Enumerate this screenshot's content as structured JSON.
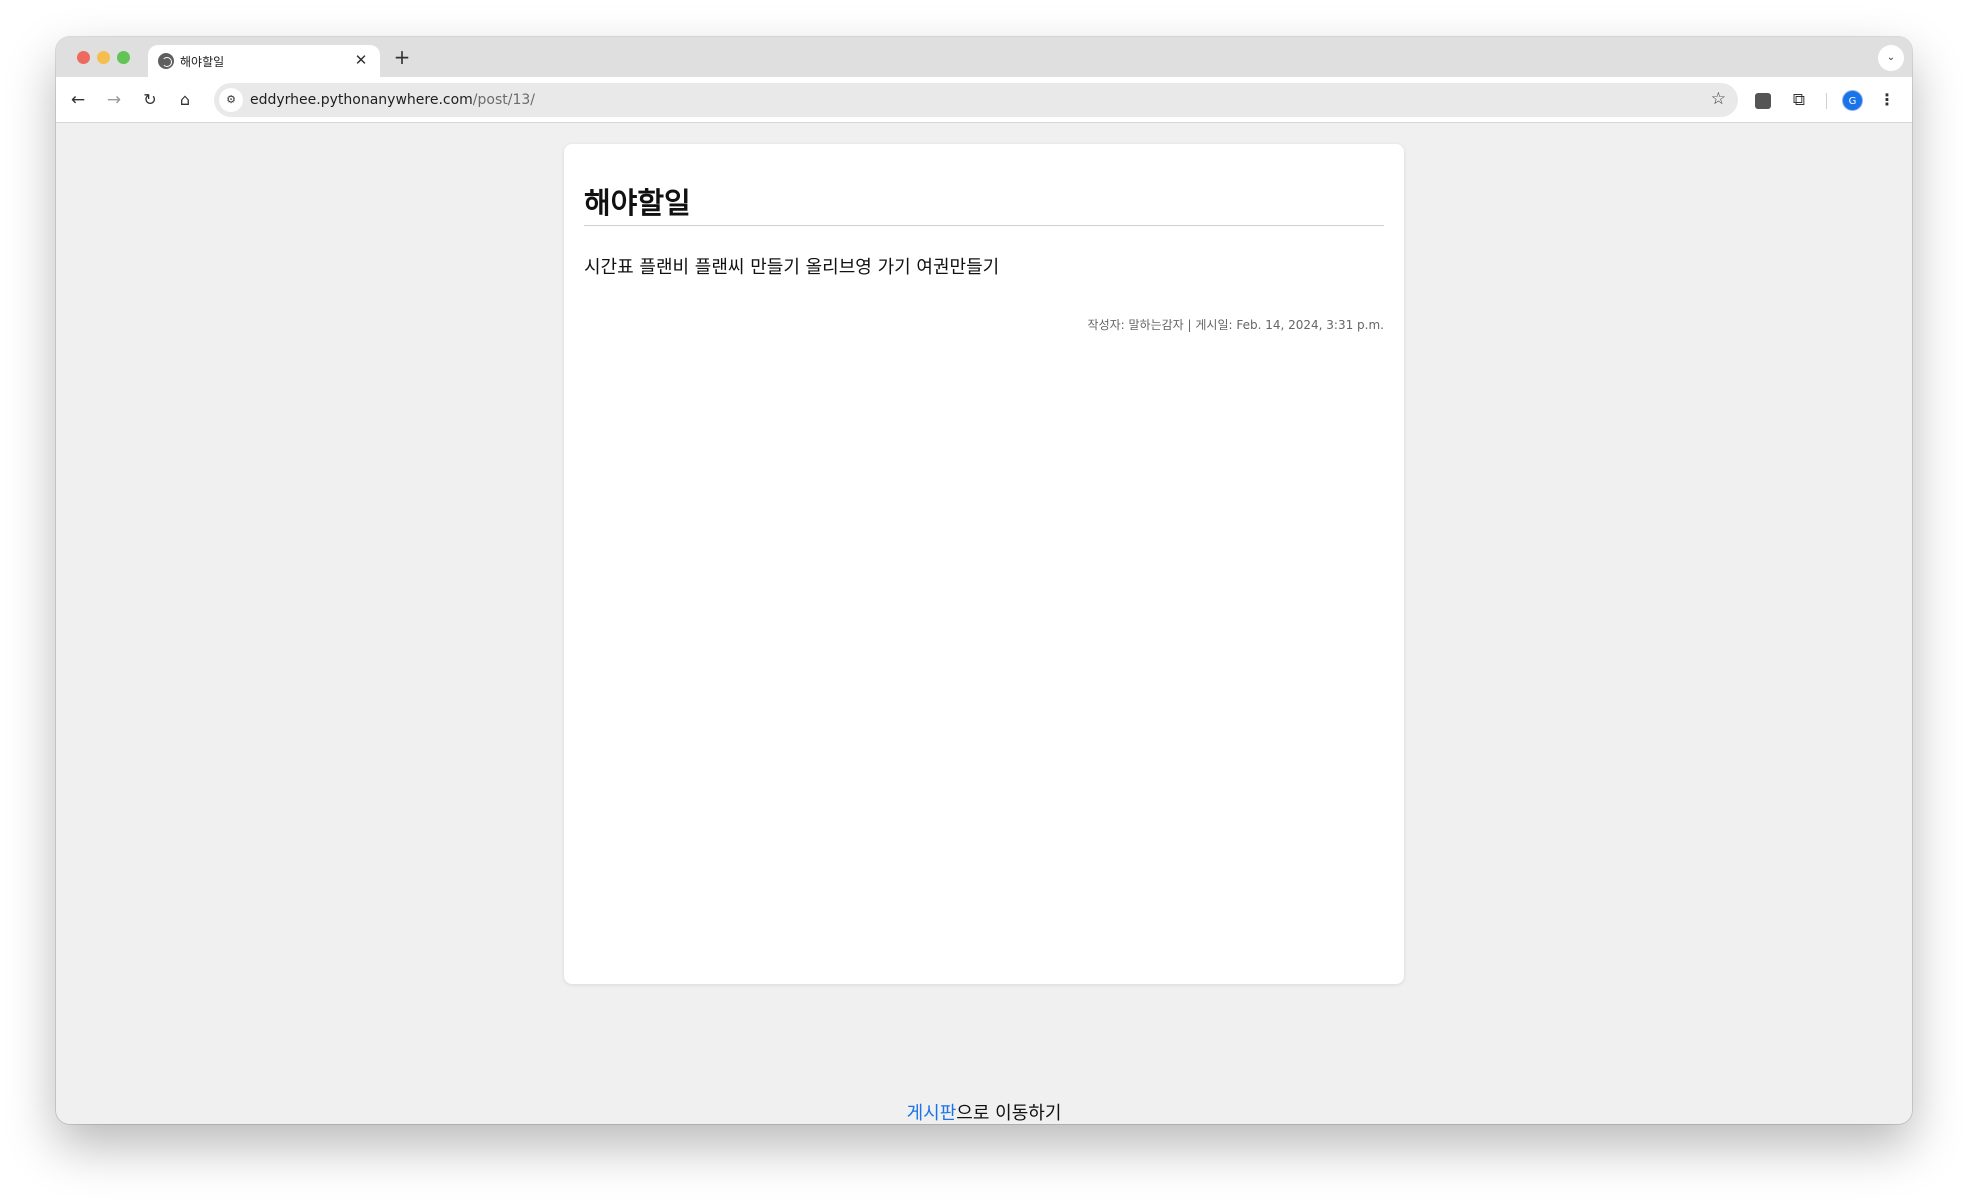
{
  "browser": {
    "tab": {
      "title": "해야할일",
      "favicon": "globe-icon",
      "close_glyph": "✕"
    },
    "new_tab_glyph": "+",
    "tab_menu_glyph": "⌄",
    "toolbar": {
      "back_glyph": "←",
      "forward_glyph": "→",
      "reload_glyph": "↻",
      "home_glyph": "⌂",
      "site_info_glyph": "⚙",
      "url_host": "eddyrhee.pythonanywhere.com",
      "url_path": "/post/13/",
      "bookmark_glyph": "☆",
      "extensions_glyph": "⧉",
      "menu_glyph": "⋮",
      "avatar_initial": "G"
    }
  },
  "post": {
    "title": "해야할일",
    "body": "시간표 플랜비 플랜씨 만들기 올리브영 가기 여권만들기",
    "meta": "작성자: 말하는감자 | 게시일: Feb. 14, 2024, 3:31 p.m."
  },
  "footer": {
    "link_text": "게시판",
    "suffix": "으로 이동하기"
  },
  "colors": {
    "accent": "#1a73e8",
    "page_background": "#f0f0f0",
    "card_background": "#ffffff"
  }
}
